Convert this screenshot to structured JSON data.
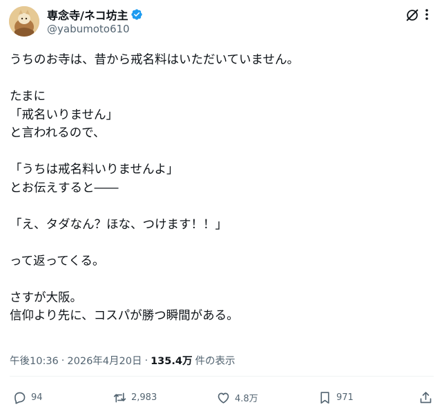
{
  "user": {
    "display_name": "専念寺/ネコ坊主",
    "handle": "@yabumoto610",
    "verified": true,
    "avatar_icon": "avatar-image"
  },
  "header_icons": {
    "grok": "grok-icon",
    "more": "more-icon"
  },
  "post": {
    "lines": [
      "うちのお寺は、昔から戒名料はいただいていません。",
      "",
      "たまに",
      "「戒名いりません」",
      "と言われるので、",
      "",
      "「うちは戒名料いりませんよ」",
      "とお伝えすると――",
      "",
      "「え、タダなん？ほな、つけます！！」",
      "",
      "って返ってくる。",
      "",
      "さすが大阪。",
      "信仰より先に、コスパが勝つ瞬間がある。"
    ]
  },
  "meta": {
    "time": "午後10:36",
    "separator": "·",
    "date": "2026年4月20日",
    "views_count": "135.4万",
    "views_label": "件の表示"
  },
  "actions": {
    "reply": {
      "icon": "reply-icon",
      "count": "94"
    },
    "repost": {
      "icon": "repost-icon",
      "count": "2,983"
    },
    "like": {
      "icon": "like-icon",
      "count": "4.8万"
    },
    "bookmark": {
      "icon": "bookmark-icon",
      "count": "971"
    },
    "share": {
      "icon": "share-icon"
    }
  },
  "colors": {
    "text": "#0f1419",
    "secondary": "#536471",
    "verified_blue": "#1d9bf0",
    "divider": "#eff3f4"
  }
}
